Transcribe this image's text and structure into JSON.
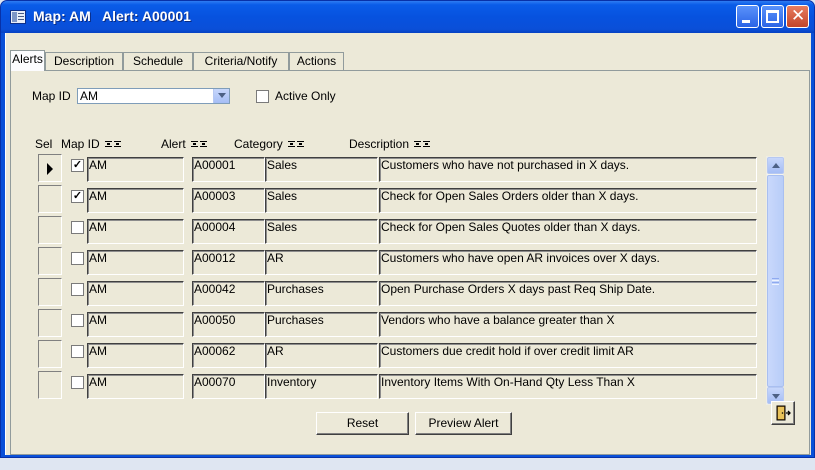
{
  "window": {
    "title": "Map: AM   Alert: A00001"
  },
  "tabs": [
    {
      "label": "Alerts"
    },
    {
      "label": "Description"
    },
    {
      "label": "Schedule"
    },
    {
      "label": "Criteria/Notify"
    },
    {
      "label": "Actions"
    }
  ],
  "filters": {
    "map_id_label": "Map ID",
    "map_id_value": "AM",
    "active_only_label": "Active Only",
    "active_only_checked": false
  },
  "columns": {
    "sel": "Sel",
    "map_id": "Map ID",
    "alert": "Alert",
    "category": "Category",
    "description": "Description"
  },
  "rows": [
    {
      "selected": "✓",
      "map_id": "AM",
      "alert": "A00001",
      "category": "Sales",
      "description": "Customers who have not purchased in X days."
    },
    {
      "selected": "✓",
      "map_id": "AM",
      "alert": "A00003",
      "category": "Sales",
      "description": "Check for Open Sales Orders older than X days."
    },
    {
      "selected": "",
      "map_id": "AM",
      "alert": "A00004",
      "category": "Sales",
      "description": "Check for Open Sales Quotes older than X days."
    },
    {
      "selected": "",
      "map_id": "AM",
      "alert": "A00012",
      "category": "AR",
      "description": "Customers who have open AR invoices over X days."
    },
    {
      "selected": "",
      "map_id": "AM",
      "alert": "A00042",
      "category": "Purchases",
      "description": "Open Purchase Orders X days past Req Ship Date."
    },
    {
      "selected": "",
      "map_id": "AM",
      "alert": "A00050",
      "category": "Purchases",
      "description": "Vendors who have a balance greater than X"
    },
    {
      "selected": "",
      "map_id": "AM",
      "alert": "A00062",
      "category": "AR",
      "description": "Customers due credit hold if over credit limit AR"
    },
    {
      "selected": "",
      "map_id": "AM",
      "alert": "A00070",
      "category": "Inventory",
      "description": "Inventory Items With On-Hand Qty Less Than X"
    }
  ],
  "buttons": {
    "reset": "Reset",
    "preview": "Preview Alert"
  },
  "icons": {
    "exit": "exit-door-icon"
  },
  "colors": {
    "titlebar": "#0a52dd",
    "form_background": "#ece9d8"
  }
}
